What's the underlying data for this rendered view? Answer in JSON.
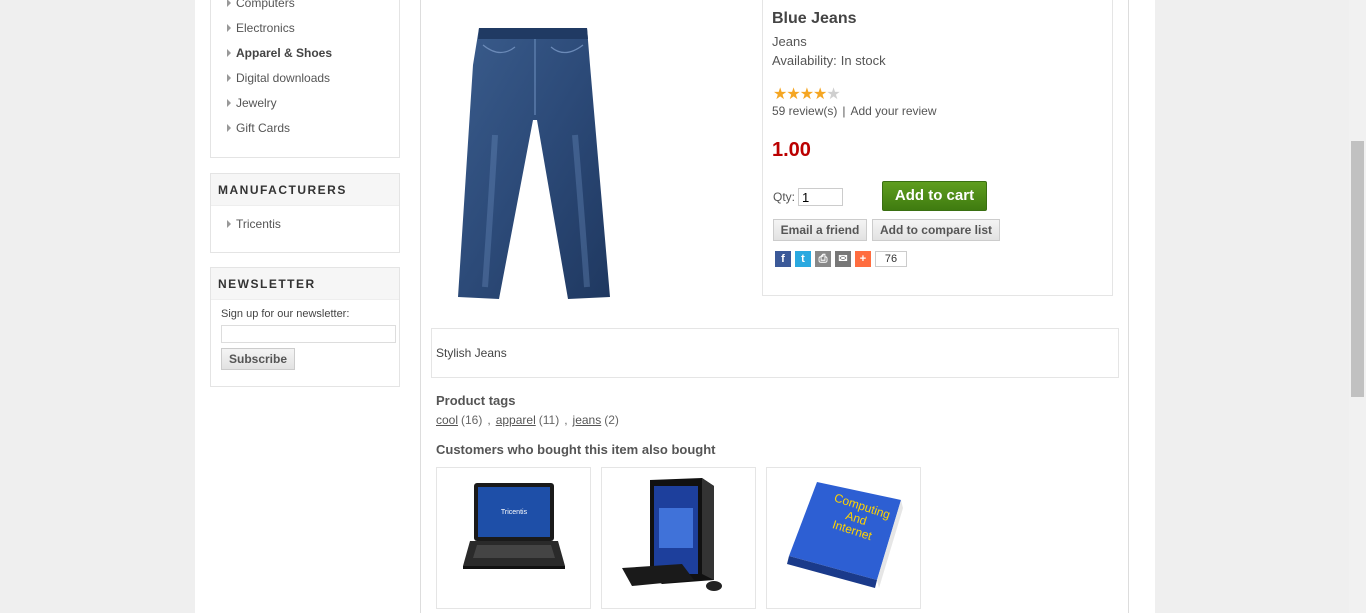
{
  "categories": {
    "items": [
      {
        "label": "Computers"
      },
      {
        "label": "Electronics"
      },
      {
        "label": "Apparel & Shoes",
        "active": true
      },
      {
        "label": "Digital downloads"
      },
      {
        "label": "Jewelry"
      },
      {
        "label": "Gift Cards"
      }
    ]
  },
  "manufacturers": {
    "title": "MANUFACTURERS",
    "items": [
      {
        "label": "Tricentis"
      }
    ]
  },
  "newsletter": {
    "title": "NEWSLETTER",
    "label": "Sign up for our newsletter:",
    "input_value": "",
    "subscribe_label": "Subscribe"
  },
  "product": {
    "name": "Blue Jeans",
    "short_description": "Jeans",
    "availability_label": "Availability:",
    "availability_value": "In stock",
    "rating": 4,
    "rating_max": 5,
    "reviews_link": "59 review(s)",
    "review_separator": "|",
    "add_review_link": "Add your review",
    "price": "1.00",
    "qty_label": "Qty:",
    "qty_value": "1",
    "add_to_cart_label": "Add to cart",
    "email_friend_label": "Email a friend",
    "compare_label": "Add to compare list",
    "share_count": "76",
    "full_description": "Stylish Jeans"
  },
  "tags": {
    "title": "Product tags",
    "items": [
      {
        "name": "cool",
        "count": "(16)"
      },
      {
        "name": "apparel",
        "count": "(11)"
      },
      {
        "name": "jeans",
        "count": "(2)"
      }
    ],
    "separator": ","
  },
  "also_bought": {
    "title": "Customers who bought this item also bought",
    "laptop_brand": "Tricentis",
    "book_title": [
      "Computing",
      "And",
      "Internet"
    ]
  },
  "colors": {
    "price": "#bb0000",
    "cart_button": "#4a8a15",
    "background": "#efefef"
  }
}
